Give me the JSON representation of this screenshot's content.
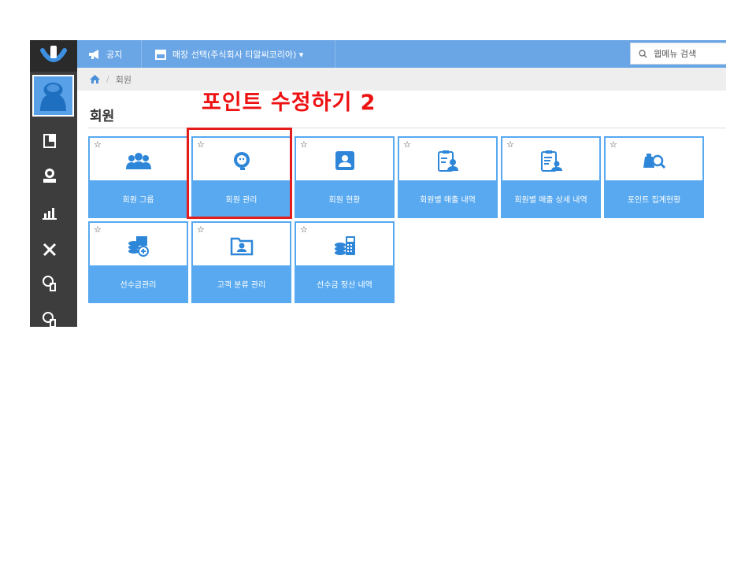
{
  "topbar": {
    "notice_label": "공지",
    "store_label": "매장 선택(주식회사 티알씨코리아) ▾",
    "search_placeholder": "웹메뉴 검색"
  },
  "breadcrumb": {
    "current": "회원"
  },
  "page": {
    "title": "회원"
  },
  "annotation": {
    "text": "포인트 수정하기 2",
    "color": "#ee1111"
  },
  "tiles": [
    {
      "label": "회원 그룹",
      "icon": "member-group-icon"
    },
    {
      "label": "회원 관리",
      "icon": "member-management-icon"
    },
    {
      "label": "회원 현황",
      "icon": "member-status-icon"
    },
    {
      "label": "회원별 매출 내역",
      "icon": "member-sales-history-icon"
    },
    {
      "label": "회원별 매출 상세 내역",
      "icon": "member-sales-detail-icon"
    },
    {
      "label": "포인트 집계현황",
      "icon": "point-summary-icon"
    },
    {
      "label": "선수금관리",
      "icon": "prepayment-management-icon"
    },
    {
      "label": "고객 분류 관리",
      "icon": "customer-category-icon"
    },
    {
      "label": "선수금 정산 내역",
      "icon": "prepayment-settlement-icon"
    }
  ],
  "tile_star": "☆",
  "colors": {
    "accent": "#58a9ef",
    "topbar": "#6aa6e6",
    "rail": "#3d3d3d"
  }
}
